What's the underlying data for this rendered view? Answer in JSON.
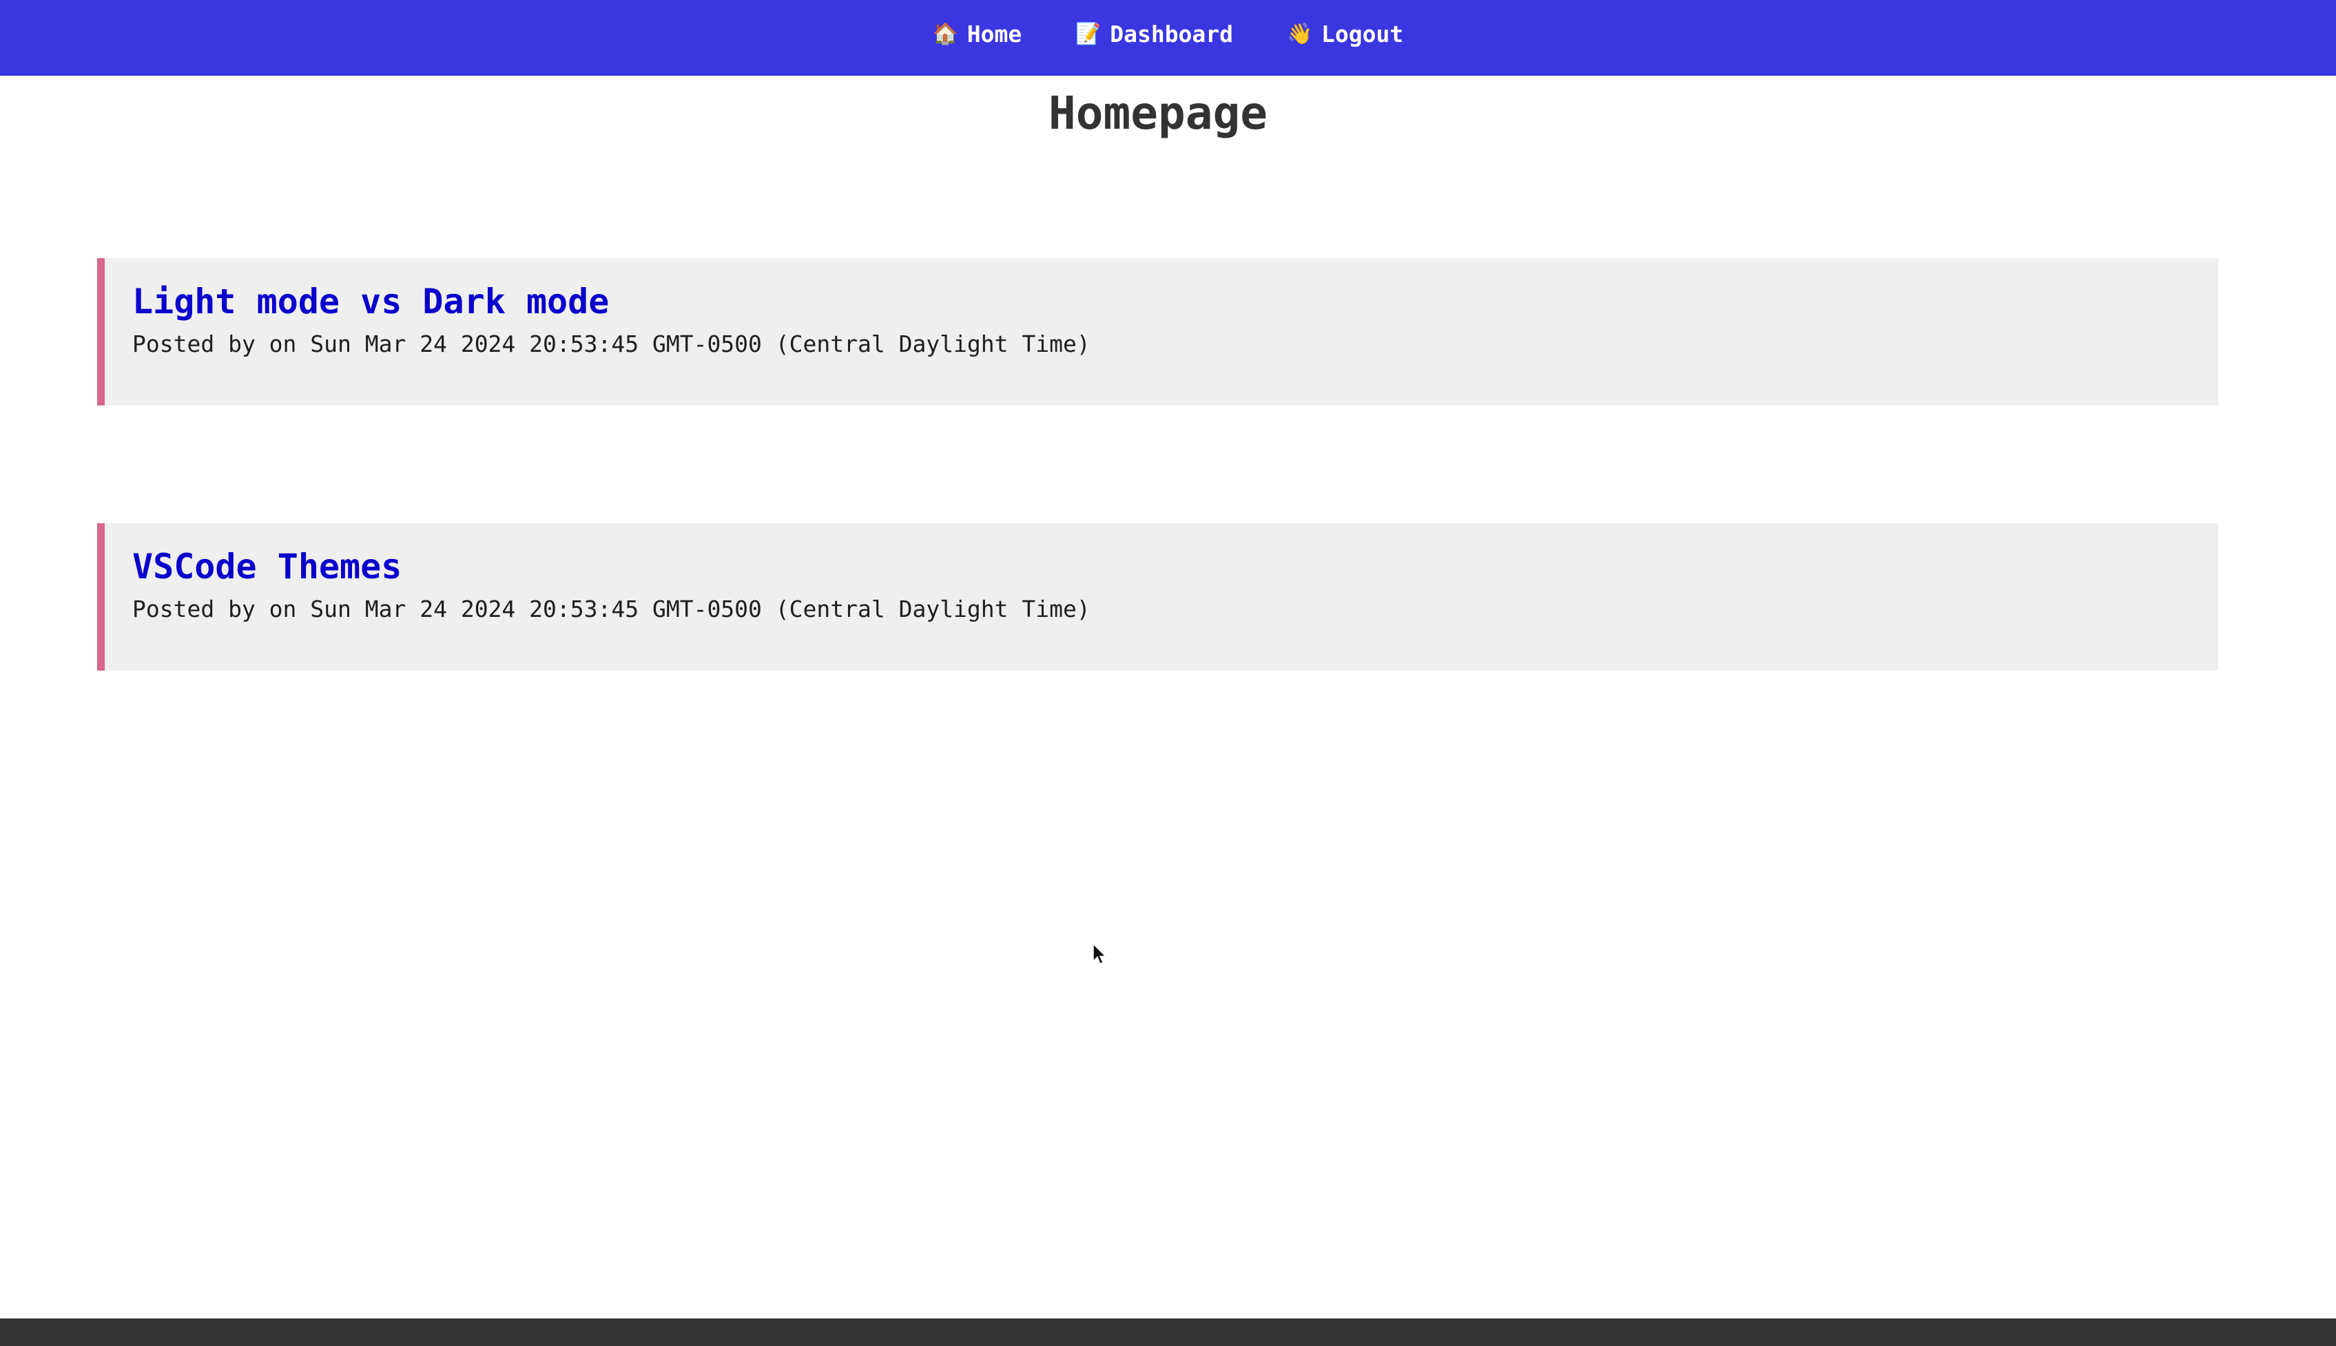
{
  "nav": {
    "items": [
      {
        "icon": "house-icon",
        "emoji": "🏠",
        "label": "Home"
      },
      {
        "icon": "memo-icon",
        "emoji": "📝",
        "label": "Dashboard"
      },
      {
        "icon": "waving-hand-icon",
        "emoji": "👋",
        "label": "Logout"
      }
    ]
  },
  "page": {
    "title": "Homepage"
  },
  "posts": [
    {
      "title": "Light mode vs Dark mode",
      "meta": "Posted by on Sun Mar 24 2024 20:53:45 GMT-0500 (Central Daylight Time)"
    },
    {
      "title": "VSCode Themes",
      "meta": "Posted by on Sun Mar 24 2024 20:53:45 GMT-0500 (Central Daylight Time)"
    }
  ],
  "colors": {
    "navbar": "#3a36e0",
    "post_accent": "#d8668a",
    "post_title": "#0a00cc",
    "post_background": "#efefef",
    "footer": "#333333"
  }
}
